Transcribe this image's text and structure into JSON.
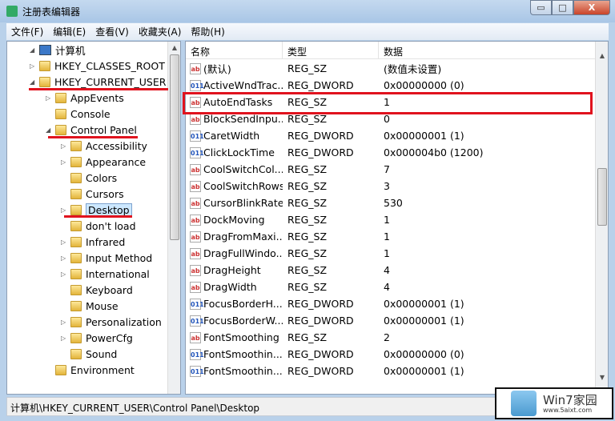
{
  "window": {
    "title": "注册表编辑器",
    "minimize": "▭",
    "maximize": "□",
    "close": "X"
  },
  "menu": [
    "文件(F)",
    "编辑(E)",
    "查看(V)",
    "收藏夹(A)",
    "帮助(H)"
  ],
  "tree": [
    {
      "label": "计算机",
      "level": 0,
      "expander": "◢",
      "icon": "computer"
    },
    {
      "label": "HKEY_CLASSES_ROOT",
      "level": 1,
      "expander": "▷",
      "icon": "folder"
    },
    {
      "label": "HKEY_CURRENT_USER",
      "level": 1,
      "expander": "◢",
      "icon": "folder"
    },
    {
      "label": "AppEvents",
      "level": 2,
      "expander": "▷",
      "icon": "folder"
    },
    {
      "label": "Console",
      "level": 2,
      "expander": "",
      "icon": "folder"
    },
    {
      "label": "Control Panel",
      "level": 2,
      "expander": "◢",
      "icon": "folder"
    },
    {
      "label": "Accessibility",
      "level": 3,
      "expander": "▷",
      "icon": "folder"
    },
    {
      "label": "Appearance",
      "level": 3,
      "expander": "▷",
      "icon": "folder"
    },
    {
      "label": "Colors",
      "level": 3,
      "expander": "",
      "icon": "folder"
    },
    {
      "label": "Cursors",
      "level": 3,
      "expander": "",
      "icon": "folder"
    },
    {
      "label": "Desktop",
      "level": 3,
      "expander": "▷",
      "icon": "folder",
      "selected": true
    },
    {
      "label": "don't load",
      "level": 3,
      "expander": "",
      "icon": "folder"
    },
    {
      "label": "Infrared",
      "level": 3,
      "expander": "▷",
      "icon": "folder"
    },
    {
      "label": "Input Method",
      "level": 3,
      "expander": "▷",
      "icon": "folder"
    },
    {
      "label": "International",
      "level": 3,
      "expander": "▷",
      "icon": "folder"
    },
    {
      "label": "Keyboard",
      "level": 3,
      "expander": "",
      "icon": "folder"
    },
    {
      "label": "Mouse",
      "level": 3,
      "expander": "",
      "icon": "folder"
    },
    {
      "label": "Personalization",
      "level": 3,
      "expander": "▷",
      "icon": "folder"
    },
    {
      "label": "PowerCfg",
      "level": 3,
      "expander": "▷",
      "icon": "folder"
    },
    {
      "label": "Sound",
      "level": 3,
      "expander": "",
      "icon": "folder"
    },
    {
      "label": "Environment",
      "level": 2,
      "expander": "",
      "icon": "folder"
    }
  ],
  "columns": [
    "名称",
    "类型",
    "数据"
  ],
  "values": [
    {
      "name": "(默认)",
      "type": "REG_SZ",
      "data": "(数值未设置)",
      "icon": "ab"
    },
    {
      "name": "ActiveWndTrac...",
      "type": "REG_DWORD",
      "data": "0x00000000 (0)",
      "icon": "bin"
    },
    {
      "name": "AutoEndTasks",
      "type": "REG_SZ",
      "data": "1",
      "icon": "ab"
    },
    {
      "name": "BlockSendInpu...",
      "type": "REG_SZ",
      "data": "0",
      "icon": "ab"
    },
    {
      "name": "CaretWidth",
      "type": "REG_DWORD",
      "data": "0x00000001 (1)",
      "icon": "bin"
    },
    {
      "name": "ClickLockTime",
      "type": "REG_DWORD",
      "data": "0x000004b0 (1200)",
      "icon": "bin"
    },
    {
      "name": "CoolSwitchCol...",
      "type": "REG_SZ",
      "data": "7",
      "icon": "ab"
    },
    {
      "name": "CoolSwitchRows",
      "type": "REG_SZ",
      "data": "3",
      "icon": "ab"
    },
    {
      "name": "CursorBlinkRate",
      "type": "REG_SZ",
      "data": "530",
      "icon": "ab"
    },
    {
      "name": "DockMoving",
      "type": "REG_SZ",
      "data": "1",
      "icon": "ab"
    },
    {
      "name": "DragFromMaxi...",
      "type": "REG_SZ",
      "data": "1",
      "icon": "ab"
    },
    {
      "name": "DragFullWindo...",
      "type": "REG_SZ",
      "data": "1",
      "icon": "ab"
    },
    {
      "name": "DragHeight",
      "type": "REG_SZ",
      "data": "4",
      "icon": "ab"
    },
    {
      "name": "DragWidth",
      "type": "REG_SZ",
      "data": "4",
      "icon": "ab"
    },
    {
      "name": "FocusBorderH...",
      "type": "REG_DWORD",
      "data": "0x00000001 (1)",
      "icon": "bin"
    },
    {
      "name": "FocusBorderW...",
      "type": "REG_DWORD",
      "data": "0x00000001 (1)",
      "icon": "bin"
    },
    {
      "name": "FontSmoothing",
      "type": "REG_SZ",
      "data": "2",
      "icon": "ab"
    },
    {
      "name": "FontSmoothin...",
      "type": "REG_DWORD",
      "data": "0x00000000 (0)",
      "icon": "bin"
    },
    {
      "name": "FontSmoothin...",
      "type": "REG_DWORD",
      "data": "0x00000001 (1)",
      "icon": "bin"
    }
  ],
  "status": "计算机\\HKEY_CURRENT_USER\\Control Panel\\Desktop",
  "watermark": {
    "title": "Win7家园",
    "url": "www.5aixt.com"
  },
  "colors": {
    "annotation": "#e0131e",
    "selection": "#cde8ff"
  }
}
